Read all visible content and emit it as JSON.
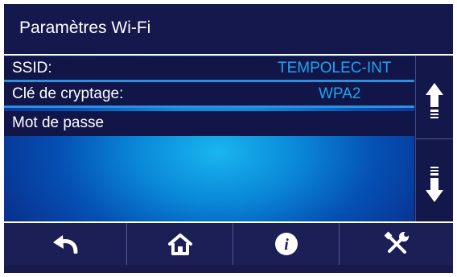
{
  "header": {
    "title": "Paramètres Wi-Fi"
  },
  "settings": {
    "ssid_label": "SSID:",
    "ssid_value": "TEMPOLEC-INT",
    "encryption_label": "Clé de cryptage:",
    "encryption_value": "WPA2",
    "password_label": "Mot de passe"
  },
  "scroll": {
    "up_icon": "arrow-up-icon",
    "down_icon": "arrow-down-icon"
  },
  "toolbar": {
    "buttons": [
      {
        "icon": "back-arrow-icon"
      },
      {
        "icon": "home-icon"
      },
      {
        "icon": "info-icon",
        "glyph": "i"
      },
      {
        "icon": "tools-icon"
      }
    ]
  },
  "colors": {
    "background": "#14164a",
    "value_text": "#1ea6f0",
    "accent_line": "#2e8fe0"
  }
}
